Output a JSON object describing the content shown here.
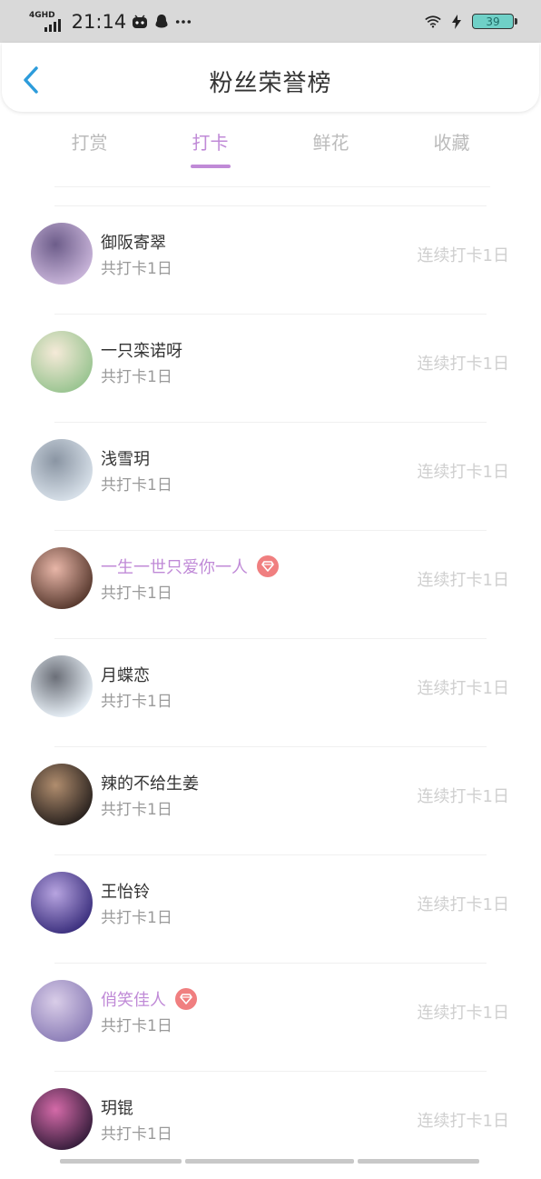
{
  "status_bar": {
    "network": "4GHD",
    "time": "21:14",
    "battery": "39",
    "icons": [
      "signal-icon",
      "bilibili-icon",
      "qq-icon",
      "more-icon",
      "wifi-icon",
      "charging-icon",
      "battery-icon"
    ]
  },
  "header": {
    "title": "粉丝荣誉榜",
    "back_icon": "chevron-left-icon"
  },
  "tabs": [
    {
      "label": "打赏",
      "active": false
    },
    {
      "label": "打卡",
      "active": true
    },
    {
      "label": "鲜花",
      "active": false
    },
    {
      "label": "收藏",
      "active": false
    }
  ],
  "fans": [
    {
      "name": "御阪寄翠",
      "total": "共打卡1日",
      "streak": "连续打卡1日",
      "vip": false,
      "avatar_colors": [
        "#c7b3d8",
        "#6d5d8a"
      ]
    },
    {
      "name": "一只栾诺呀",
      "total": "共打卡1日",
      "streak": "连续打卡1日",
      "vip": false,
      "avatar_colors": [
        "#9bc592",
        "#f5ead8"
      ]
    },
    {
      "name": "浅雪玥",
      "total": "共打卡1日",
      "streak": "连续打卡1日",
      "vip": false,
      "avatar_colors": [
        "#d6dfe8",
        "#8a95a3"
      ]
    },
    {
      "name": "一生一世只爱你一人",
      "total": "共打卡1日",
      "streak": "连续打卡1日",
      "vip": true,
      "avatar_colors": [
        "#5a3b30",
        "#e8b6a8"
      ]
    },
    {
      "name": "月蝶恋",
      "total": "共打卡1日",
      "streak": "连续打卡1日",
      "vip": false,
      "avatar_colors": [
        "#e6eef5",
        "#6b6f78"
      ]
    },
    {
      "name": "辣的不给生姜",
      "total": "共打卡1日",
      "streak": "连续打卡1日",
      "vip": false,
      "avatar_colors": [
        "#2c2420",
        "#b08d6e"
      ]
    },
    {
      "name": "王怡铃",
      "total": "共打卡1日",
      "streak": "连续打卡1日",
      "vip": false,
      "avatar_colors": [
        "#3e3280",
        "#b7a4e0"
      ]
    },
    {
      "name": "俏笑佳人",
      "total": "共打卡1日",
      "streak": "连续打卡1日",
      "vip": true,
      "avatar_colors": [
        "#8d7fb8",
        "#d9cde8"
      ]
    },
    {
      "name": "玥锟",
      "total": "共打卡1日",
      "streak": "连续打卡1日",
      "vip": false,
      "avatar_colors": [
        "#3a1f3e",
        "#d46aa8"
      ]
    }
  ],
  "colors": {
    "accent": "#c08ad7",
    "back_arrow": "#2d9cdb",
    "badge": "#f07f80",
    "muted_text": "#9a9a9a",
    "streak_text": "#cfcfcf"
  }
}
